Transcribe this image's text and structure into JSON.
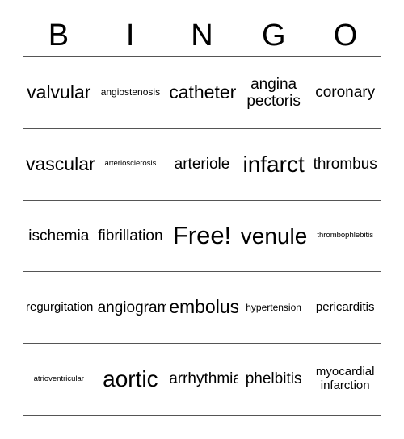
{
  "card": {
    "title_letters": [
      "B",
      "I",
      "N",
      "G",
      "O"
    ],
    "grid": {
      "columns": 5,
      "rows": 5,
      "border_color": "#555555",
      "background": "#ffffff",
      "text_color": "#000000"
    },
    "cells": [
      [
        {
          "text": "valvular",
          "size": "lg"
        },
        {
          "text": "angiostenosis",
          "size": "xs"
        },
        {
          "text": "catheter",
          "size": "lg"
        },
        {
          "text": "angina pectoris",
          "size": "md"
        },
        {
          "text": "coronary",
          "size": "md"
        }
      ],
      [
        {
          "text": "vascular",
          "size": "lg"
        },
        {
          "text": "arteriosclerosis",
          "size": "xxs"
        },
        {
          "text": "arteriole",
          "size": "md"
        },
        {
          "text": "infarct",
          "size": "xl"
        },
        {
          "text": "thrombus",
          "size": "md"
        }
      ],
      [
        {
          "text": "ischemia",
          "size": "md"
        },
        {
          "text": "fibrillation",
          "size": "md"
        },
        {
          "text": "Free!",
          "size": "xxl"
        },
        {
          "text": "venule",
          "size": "xl"
        },
        {
          "text": "thrombophlebitis",
          "size": "xxs"
        }
      ],
      [
        {
          "text": "regurgitation",
          "size": "sm"
        },
        {
          "text": "angiogram",
          "size": "md"
        },
        {
          "text": "embolus",
          "size": "lg"
        },
        {
          "text": "hypertension",
          "size": "xs"
        },
        {
          "text": "pericarditis",
          "size": "sm"
        }
      ],
      [
        {
          "text": "atrioventricular",
          "size": "xxs"
        },
        {
          "text": "aortic",
          "size": "xl"
        },
        {
          "text": "arrhythmia",
          "size": "md"
        },
        {
          "text": "phelbitis",
          "size": "md"
        },
        {
          "text": "myocardial infarction",
          "size": "sm"
        }
      ]
    ]
  }
}
